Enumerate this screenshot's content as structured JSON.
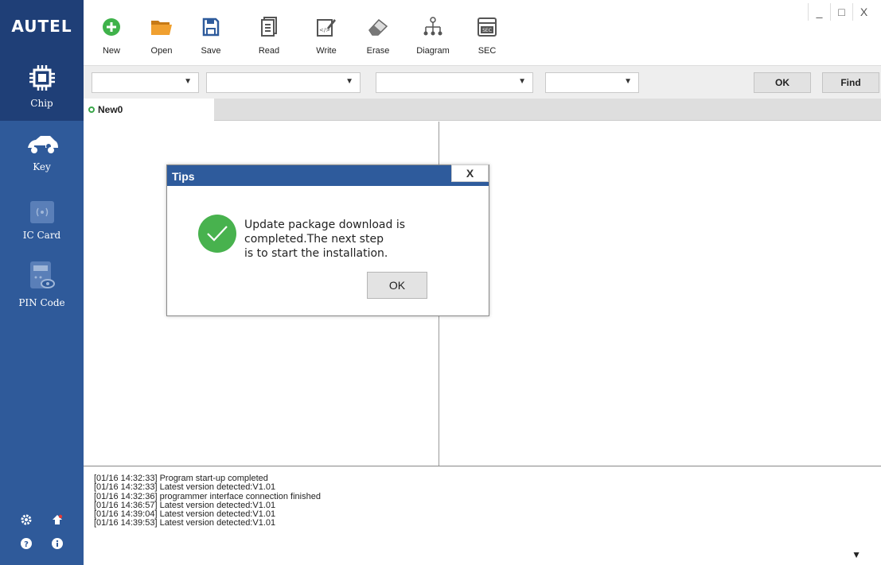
{
  "brand": {
    "logo": "AUTEL"
  },
  "sidebar": {
    "items": [
      {
        "label": "Chip"
      },
      {
        "label": "Key"
      },
      {
        "label": "IC Card"
      },
      {
        "label": "PIN Code"
      }
    ]
  },
  "toolbar": {
    "new": "New",
    "open": "Open",
    "save": "Save",
    "read": "Read",
    "write": "Write",
    "erase": "Erase",
    "diagram": "Diagram",
    "sec": "SEC",
    "sec_icon_text": "SEC"
  },
  "window_controls": {
    "minimize": "_",
    "maximize": "□",
    "close": "X"
  },
  "filters": {
    "ok_label": "OK",
    "find_label": "Find"
  },
  "tabs": [
    {
      "label": "New0"
    }
  ],
  "log": {
    "lines": [
      "[01/16 14:32:33] Program start-up completed",
      "[01/16 14:32:33] Latest version detected:V1.01",
      "[01/16 14:32:36] programmer interface connection finished",
      "[01/16 14:36:57] Latest version detected:V1.01",
      "[01/16 14:39:04] Latest version detected:V1.01",
      "[01/16 14:39:53] Latest version detected:V1.01"
    ]
  },
  "dialog": {
    "title": "Tips",
    "close": "X",
    "message_line1": "Update package download is",
    "message_line2": "completed.The next step",
    "message_line3": "is to start the installation.",
    "ok_label": "OK"
  },
  "colors": {
    "sidebar": "#2f5a9a",
    "sidebar_active": "#1f3f77",
    "success": "#48b24e",
    "toolbar_new": "#3fb24a",
    "toolbar_open": "#f0a030"
  }
}
